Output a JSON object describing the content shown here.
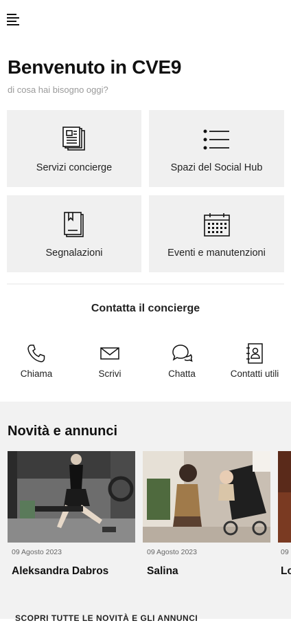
{
  "header": {
    "menu_icon": "hamburger-menu-icon"
  },
  "welcome": {
    "title": "Benvenuto in CVE9",
    "subtitle": "di cosa hai bisogno oggi?"
  },
  "tiles": [
    {
      "label": "Servizi concierge",
      "icon": "documents-icon"
    },
    {
      "label": "Spazi del Social Hub",
      "icon": "list-icon"
    },
    {
      "label": "Segnalazioni",
      "icon": "book-icon"
    },
    {
      "label": "Eventi e manutenzioni",
      "icon": "calendar-icon"
    }
  ],
  "contact": {
    "title": "Contatta il concierge",
    "buttons": [
      {
        "label": "Chiama",
        "icon": "phone-icon"
      },
      {
        "label": "Scrivi",
        "icon": "envelope-icon"
      },
      {
        "label": "Chatta",
        "icon": "chat-icon"
      },
      {
        "label": "Contatti utili",
        "icon": "contacts-book-icon"
      }
    ]
  },
  "news": {
    "title": "Novità e annunci",
    "cards": [
      {
        "date": "09 Agosto 2023",
        "name": "Aleksandra Dabros"
      },
      {
        "date": "09 Agosto 2023",
        "name": "Salina"
      },
      {
        "date": "09",
        "name": "Lo"
      }
    ],
    "all_link": "SCOPRI TUTTE LE NOVITÀ E GLI ANNUNCI"
  }
}
